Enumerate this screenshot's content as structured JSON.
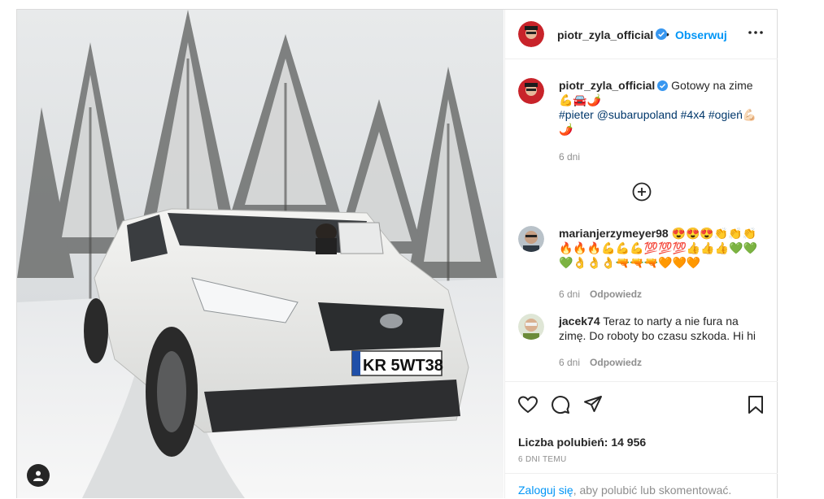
{
  "post": {
    "author": "piotr_zyla_official",
    "follow_label": "Obserwuj",
    "dot": "•",
    "caption": {
      "text": "Gotowy na zime💪🚘🌶️",
      "hashtags_line": "#pieter @subarupoland #4x4 #ogień💪🏻🌶️",
      "time": "6 dni"
    },
    "likes_text": "Liczba polubień: 14 956",
    "time_ago": "6 DNI TEMU",
    "login_link": "Zaloguj się",
    "login_text": ", aby polubić lub skomentować."
  },
  "media": {
    "plate_text": "KR 5WT38"
  },
  "comments": [
    {
      "user": "marianjerzymeyer98",
      "text": "😍😍😍👏👏👏🔥🔥🔥💪💪💪💯💯💯👍👍👍💚💚💚👌👌👌🔫🔫🔫🧡🧡🧡",
      "time": "6 dni",
      "reply": "Odpowiedz"
    },
    {
      "user": "jacek74",
      "text": "Teraz to narty a nie fura na zimę. Do roboty bo czasu szkoda. Hi hi",
      "time": "6 dni",
      "reply": "Odpowiedz"
    }
  ],
  "icons": {
    "verified": "verified-badge-icon",
    "more": "more-options-icon",
    "load_more": "plus-circle-icon",
    "like": "heart-icon",
    "comment": "comment-icon",
    "share": "share-icon",
    "save": "bookmark-icon",
    "tagged": "tagged-user-icon"
  },
  "colors": {
    "accent": "#0095f6",
    "verified": "#3897f0",
    "muted": "#8e8e8e"
  }
}
